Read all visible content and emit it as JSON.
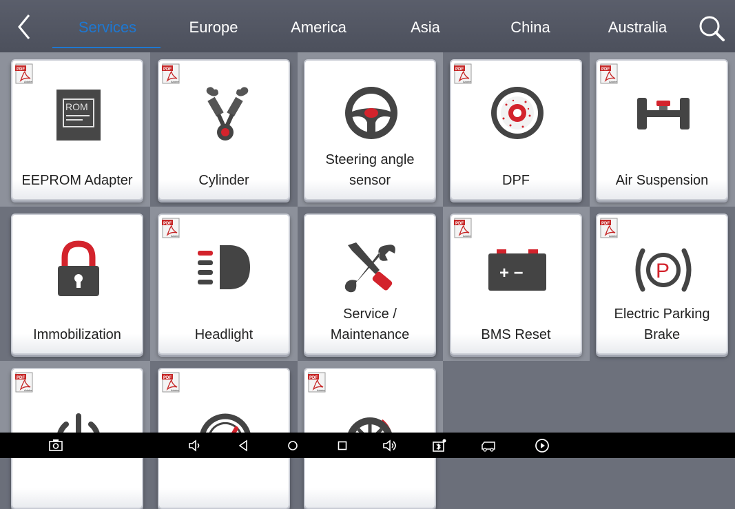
{
  "header": {
    "back_icon": "chevron-left-icon",
    "tabs": [
      {
        "label": "Services",
        "active": true
      },
      {
        "label": "Europe",
        "active": false
      },
      {
        "label": "America",
        "active": false
      },
      {
        "label": "Asia",
        "active": false
      },
      {
        "label": "China",
        "active": false
      },
      {
        "label": "Australia",
        "active": false
      }
    ],
    "search_icon": "search-icon",
    "active_color": "#1e78d2"
  },
  "cards": [
    {
      "label": "EEPROM Adapter",
      "icon": "rom-chip-icon",
      "pdf": true,
      "icon_text": "ROM"
    },
    {
      "label": "Cylinder",
      "icon": "cylinder-icon",
      "pdf": true
    },
    {
      "label": "Steering angle sensor",
      "icon": "steering-wheel-icon",
      "pdf": false
    },
    {
      "label": "DPF",
      "icon": "dpf-filter-icon",
      "pdf": true
    },
    {
      "label": "Air Suspension",
      "icon": "air-suspension-icon",
      "pdf": true
    },
    {
      "label": "Immobilization",
      "icon": "lock-icon",
      "pdf": false
    },
    {
      "label": "Headlight",
      "icon": "headlight-icon",
      "pdf": true
    },
    {
      "label": "Service / Maintenance",
      "icon": "wrench-screwdriver-icon",
      "pdf": false
    },
    {
      "label": "BMS Reset",
      "icon": "battery-icon",
      "pdf": true,
      "battery_text": "+ −"
    },
    {
      "label": "Electric Parking Brake",
      "icon": "parking-brake-icon",
      "pdf": true,
      "icon_text": "P"
    },
    {
      "label": "",
      "icon": "power-icon",
      "pdf": true
    },
    {
      "label": "",
      "icon": "gauge-icon",
      "pdf": true
    },
    {
      "label": "",
      "icon": "tire-icon",
      "pdf": true
    }
  ],
  "pdf_badge": {
    "top_text": "PDF",
    "bottom_text": "Adobe"
  },
  "navbar": {
    "icons": [
      "screenshot-icon",
      "volume-down-icon",
      "back-triangle-icon",
      "home-circle-icon",
      "recents-square-icon",
      "volume-up-icon",
      "bluetooth-vci-icon",
      "truck-icon",
      "play-circle-icon"
    ]
  },
  "colors": {
    "accent_red": "#d3232c",
    "icon_gray": "#444444"
  }
}
